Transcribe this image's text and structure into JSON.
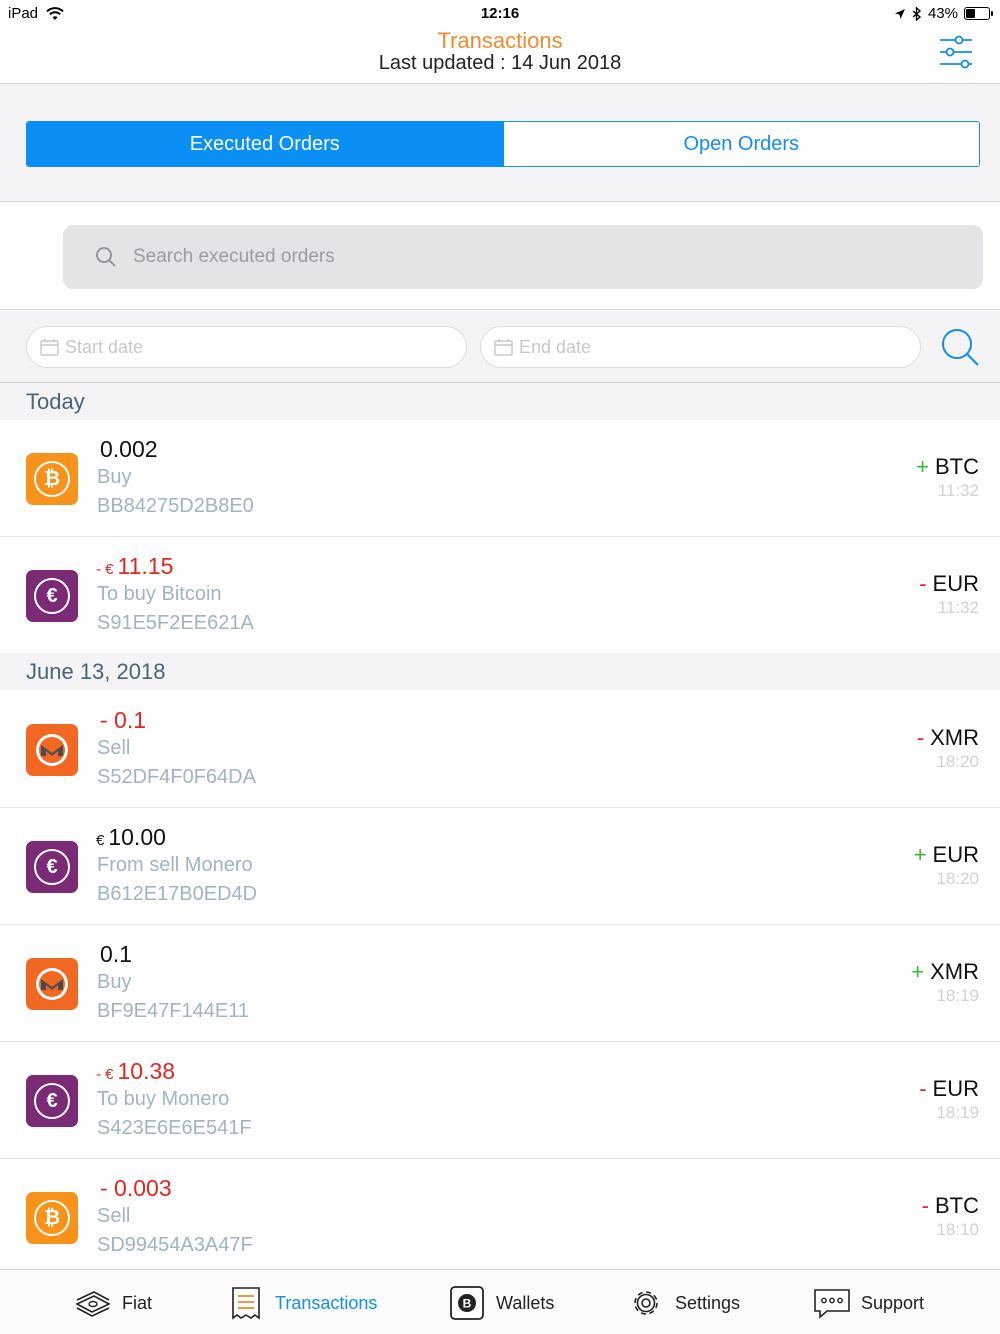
{
  "status_bar": {
    "device": "iPad",
    "time": "12:16",
    "battery": "43%",
    "battery_level": 0.43
  },
  "header": {
    "title": "Transactions",
    "subtitle": "Last updated : 14 Jun 2018",
    "filter_icon": "sliders-icon"
  },
  "segmented": {
    "executed_label": "Executed Orders",
    "open_label": "Open Orders",
    "selected": "executed"
  },
  "search": {
    "placeholder": "Search executed orders",
    "value": ""
  },
  "date_filter": {
    "start_placeholder": "Start date",
    "end_placeholder": "End date"
  },
  "sections": [
    {
      "title": "Today",
      "transactions": [
        {
          "coin": "btc",
          "amount_symbol": "",
          "amount": "0.002",
          "negative": false,
          "label": "Buy",
          "id": "BB84275D2B8E0",
          "sign": "+",
          "currency": "BTC",
          "time": "11:32"
        },
        {
          "coin": "eur",
          "amount_symbol": "- €",
          "amount": "11.15",
          "negative": true,
          "label": "To buy Bitcoin",
          "id": "S91E5F2EE621A",
          "sign": "-",
          "currency": "EUR",
          "time": "11:32"
        }
      ]
    },
    {
      "title": "June 13, 2018",
      "transactions": [
        {
          "coin": "xmr",
          "amount_symbol": "",
          "amount": "- 0.1",
          "negative": true,
          "label": "Sell",
          "id": "S52DF4F0F64DA",
          "sign": "-",
          "currency": "XMR",
          "time": "18:20"
        },
        {
          "coin": "eur",
          "amount_symbol": "€",
          "amount": "10.00",
          "negative": false,
          "label": "From sell Monero",
          "id": "B612E17B0ED4D",
          "sign": "+",
          "currency": "EUR",
          "time": "18:20"
        },
        {
          "coin": "xmr",
          "amount_symbol": "",
          "amount": "0.1",
          "negative": false,
          "label": "Buy",
          "id": "BF9E47F144E11",
          "sign": "+",
          "currency": "XMR",
          "time": "18:19"
        },
        {
          "coin": "eur",
          "amount_symbol": "- €",
          "amount": "10.38",
          "negative": true,
          "label": "To buy Monero",
          "id": "S423E6E6E541F",
          "sign": "-",
          "currency": "EUR",
          "time": "18:19"
        },
        {
          "coin": "btc",
          "amount_symbol": "",
          "amount": "- 0.003",
          "negative": true,
          "label": "Sell",
          "id": "SD99454A3A47F",
          "sign": "-",
          "currency": "BTC",
          "time": "18:10"
        }
      ]
    }
  ],
  "tabs": [
    {
      "label": "Fiat",
      "icon": "banknotes-icon"
    },
    {
      "label": "Transactions",
      "icon": "receipt-icon",
      "active": true
    },
    {
      "label": "Wallets",
      "icon": "wallet-icon"
    },
    {
      "label": "Settings",
      "icon": "gear-icon"
    },
    {
      "label": "Support",
      "icon": "chat-bubble-icon"
    }
  ],
  "colors": {
    "accent": "#118ef5",
    "title_orange": "#f08a2c",
    "negative": "#e8241d",
    "positive": "#3cb434",
    "btc": "#f7931a",
    "eur": "#7b2a75",
    "xmr": "#f26822"
  }
}
